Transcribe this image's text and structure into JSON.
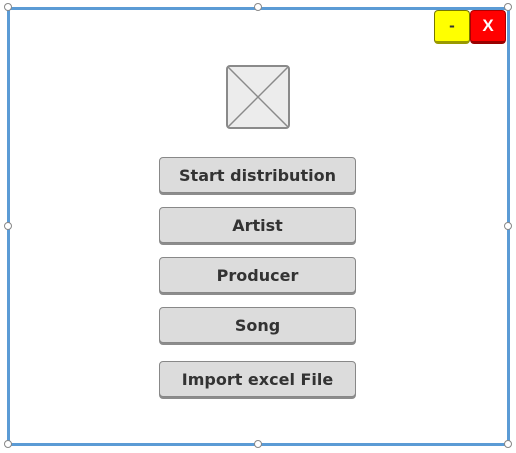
{
  "window": {
    "minimize_label": "-",
    "close_label": "X",
    "minimize_color": "#ffff00",
    "close_color": "#ff0000",
    "frame_color": "#5b9bd5"
  },
  "logo": {
    "icon": "image-placeholder-icon"
  },
  "menu": {
    "buttons": [
      {
        "label": "Start distribution"
      },
      {
        "label": "Artist"
      },
      {
        "label": "Producer"
      },
      {
        "label": "Song"
      },
      {
        "label": "Import excel File"
      }
    ]
  }
}
